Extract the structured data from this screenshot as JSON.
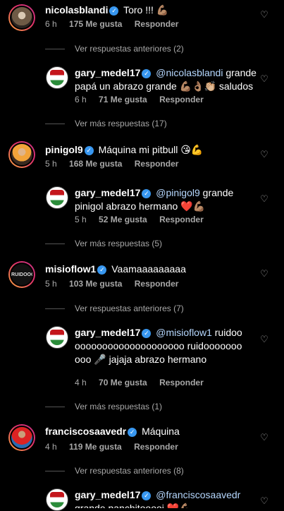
{
  "comments": [
    {
      "username": "nicolasblandi",
      "text": "Toro !!! 💪🏽",
      "time": "6 h",
      "likes": "175 Me gusta",
      "reply": "Responder"
    },
    {
      "username": "gary_medel17",
      "mention": "@nicolasblandi",
      "text": " grande papá un abrazo grande 💪🏽👌🏽👏🏼 saludos",
      "time": "6 h",
      "likes": "71 Me gusta",
      "reply": "Responder"
    },
    {
      "username": "pinigol9",
      "text": "Máquina mi pitbull 😘💪",
      "time": "5 h",
      "likes": "168 Me gusta",
      "reply": "Responder"
    },
    {
      "username": "gary_medel17",
      "mention": "@pinigol9",
      "text": " grande pinigol abrazo hermano ❤️💪🏽",
      "time": "5 h",
      "likes": "52 Me gusta",
      "reply": "Responder"
    },
    {
      "username": "misioflow1",
      "text": "Vaamaaaaaaaaa",
      "time": "5 h",
      "likes": "103 Me gusta",
      "reply": "Responder"
    },
    {
      "username": "gary_medel17",
      "mention": "@misioflow1",
      "text": " ruidoooooooooooooooooooooo ruidoooooooooo 🎤 jajaja abrazo hermano",
      "time": "4 h",
      "likes": "70 Me gusta",
      "reply": "Responder"
    },
    {
      "username": "franciscosaavedr",
      "text": "Máquina",
      "time": "4 h",
      "likes": "119 Me gusta",
      "reply": "Responder"
    },
    {
      "username": "gary_medel17",
      "mention": "@franciscosaavedr",
      "text": " grande panchitooooi ❤️💪🏽"
    }
  ],
  "threads": [
    "Ver respuestas anteriores (2)",
    "Ver más respuestas (17)",
    "Ver más respuestas (5)",
    "Ver respuestas anteriores (7)",
    "Ver más respuestas (1)",
    "Ver respuestas anteriores (8)"
  ],
  "misio_avatar_text": "RUIDOOOO"
}
